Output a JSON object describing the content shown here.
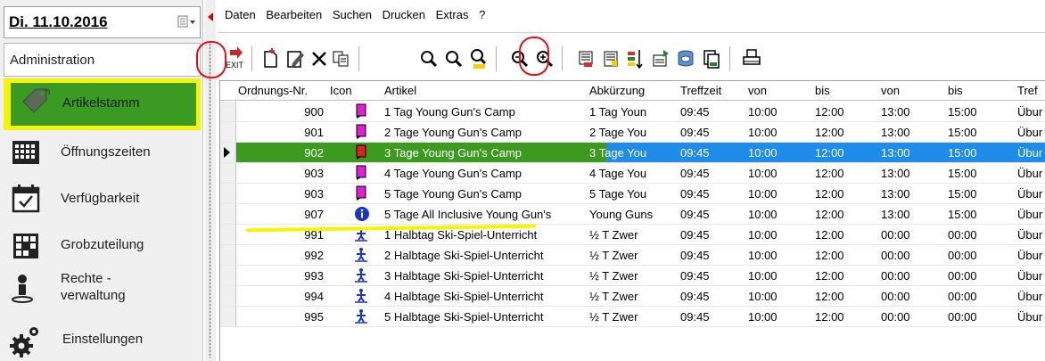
{
  "sidebar": {
    "date": "Di. 11.10.2016",
    "header": "Administration",
    "items": [
      {
        "label": "Artikelstamm",
        "icon": "tag-icon"
      },
      {
        "label": "Öffnungszeiten",
        "icon": "calendar-grid-icon"
      },
      {
        "label": "Verfügbarkeit",
        "icon": "calendar-check-icon"
      },
      {
        "label": "Grobzuteilung",
        "icon": "grid-icon"
      },
      {
        "label_line1": "Rechte -",
        "label_line2": "verwaltung",
        "icon": "user-rights-icon"
      },
      {
        "label": "Einstellungen",
        "icon": "gears-icon"
      }
    ]
  },
  "menubar": [
    "Daten",
    "Bearbeiten",
    "Suchen",
    "Drucken",
    "Extras",
    "?"
  ],
  "toolbar": {
    "exit_label": "EXIT",
    "buttons": [
      "exit-icon",
      "new-document-icon",
      "edit-icon",
      "delete-icon",
      "copy-icon",
      "search-icon",
      "search-next-icon",
      "search-number-icon",
      "zoom-out-icon",
      "zoom-in-icon",
      "list-number-icon",
      "list-icon",
      "sort-icon",
      "import-icon",
      "database-icon",
      "print-preview-icon",
      "print-icon"
    ]
  },
  "grid": {
    "columns": [
      "Ordnungs-Nr.",
      "Icon",
      "Artikel",
      "Abkürzung",
      "Treffzeit",
      "von",
      "bis",
      "von",
      "bis",
      "Tref"
    ],
    "rows": [
      {
        "nr": "900",
        "icon": "pink-flag",
        "artikel": "1 Tag Young Gun's Camp",
        "abk": "1 Tag Youn",
        "treff": "09:45",
        "von1": "10:00",
        "bis1": "12:00",
        "von2": "13:00",
        "bis2": "15:00",
        "tref": "Übur"
      },
      {
        "nr": "901",
        "icon": "pink-flag",
        "artikel": "2 Tage Young Gun's Camp",
        "abk": "2 Tage You",
        "treff": "09:45",
        "von1": "10:00",
        "bis1": "12:00",
        "von2": "13:00",
        "bis2": "15:00",
        "tref": "Übur"
      },
      {
        "nr": "902",
        "icon": "red-flag",
        "artikel": "3 Tage Young Gun's Camp",
        "abk": "3 Tage You",
        "treff": "09:45",
        "von1": "10:00",
        "bis1": "12:00",
        "von2": "13:00",
        "bis2": "15:00",
        "tref": "Übur",
        "selected": true
      },
      {
        "nr": "903",
        "icon": "pink-flag",
        "artikel": "4 Tage Young Gun's Camp",
        "abk": "4 Tage You",
        "treff": "09:45",
        "von1": "10:00",
        "bis1": "12:00",
        "von2": "13:00",
        "bis2": "15:00",
        "tref": "Übur"
      },
      {
        "nr": "903",
        "icon": "pink-flag",
        "artikel": "5 Tage Young Gun's Camp",
        "abk": "5 Tage You",
        "treff": "09:45",
        "von1": "10:00",
        "bis1": "12:00",
        "von2": "13:00",
        "bis2": "15:00",
        "tref": "Übur"
      },
      {
        "nr": "907",
        "icon": "info",
        "artikel": "5 Tage All Inclusive Young Gun's",
        "abk": "Young Guns",
        "treff": "09:45",
        "von1": "10:00",
        "bis1": "12:00",
        "von2": "13:00",
        "bis2": "15:00",
        "tref": "Übur"
      },
      {
        "nr": "991",
        "icon": "skier",
        "artikel": "1 Halbtag Ski-Spiel-Unterricht",
        "abk": "½ T Zwer",
        "treff": "09:45",
        "von1": "10:00",
        "bis1": "12:00",
        "von2": "00:00",
        "bis2": "00:00",
        "tref": "Übur"
      },
      {
        "nr": "992",
        "icon": "skier",
        "artikel": "2 Halbtage Ski-Spiel-Unterricht",
        "abk": "½ T Zwer",
        "treff": "09:45",
        "von1": "10:00",
        "bis1": "12:00",
        "von2": "00:00",
        "bis2": "00:00",
        "tref": "Übur"
      },
      {
        "nr": "993",
        "icon": "skier",
        "artikel": "3 Halbtage Ski-Spiel-Unterricht",
        "abk": "½ T Zwer",
        "treff": "09:45",
        "von1": "10:00",
        "bis1": "12:00",
        "von2": "00:00",
        "bis2": "00:00",
        "tref": "Übur"
      },
      {
        "nr": "994",
        "icon": "skier",
        "artikel": "4 Halbtage Ski-Spiel-Unterricht",
        "abk": "½ T Zwer",
        "treff": "09:45",
        "von1": "10:00",
        "bis1": "12:00",
        "von2": "00:00",
        "bis2": "00:00",
        "tref": "Übur"
      },
      {
        "nr": "995",
        "icon": "skier",
        "artikel": "5 Halbtage Ski-Spiel-Unterricht",
        "abk": "½ T Zwer",
        "treff": "09:45",
        "von1": "10:00",
        "bis1": "12:00",
        "von2": "00:00",
        "bis2": "00:00",
        "tref": "Übur"
      }
    ]
  },
  "colors": {
    "highlight_yellow": "#f5f500",
    "nav_selected_green": "#3a9a22",
    "row_selected_blue": "#1e8ce8",
    "annotation_red": "#e0111b"
  }
}
